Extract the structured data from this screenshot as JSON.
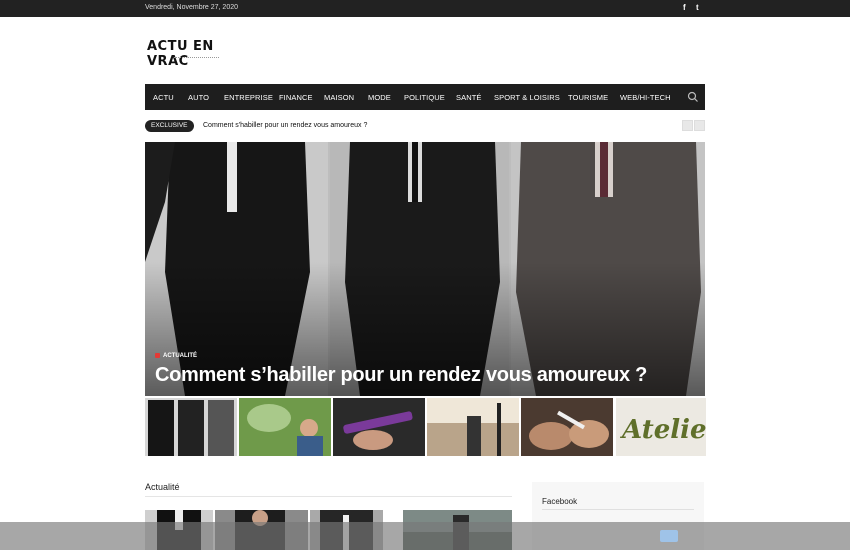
{
  "topbar": {
    "date": "Vendredi, Novembre 27, 2020",
    "social": [
      "f",
      "t"
    ]
  },
  "site": {
    "logo": "ACTU EN VRAC"
  },
  "nav": {
    "items": [
      "ACTU",
      "AUTO",
      "ENTREPRISE",
      "FINANCE",
      "MAISON",
      "MODE",
      "POLITIQUE",
      "SANTÉ",
      "SPORT & LOISIRS",
      "TOURISME",
      "WEB/HI-TECH"
    ],
    "search_icon": "search-icon"
  },
  "ticker": {
    "badge": "EXCLUSIVE",
    "text": "Comment s'habiller pour un rendez vous amoureux ?"
  },
  "hero": {
    "category": "ACTUALITÉ",
    "title": "Comment s’habiller pour un rendez vous amoureux ?"
  },
  "thumbs": [
    {
      "name": "suits"
    },
    {
      "name": "vaping-man"
    },
    {
      "name": "e-cigarette"
    },
    {
      "name": "city-window"
    },
    {
      "name": "cigarettes"
    },
    {
      "name": "atelier-sign"
    }
  ],
  "section": {
    "title": "Actualité"
  },
  "sidebar": {
    "title": "Facebook"
  },
  "colors": {
    "accent": "#e53935",
    "nav_bg": "#1e1e1e",
    "topbar_bg": "#222222"
  }
}
